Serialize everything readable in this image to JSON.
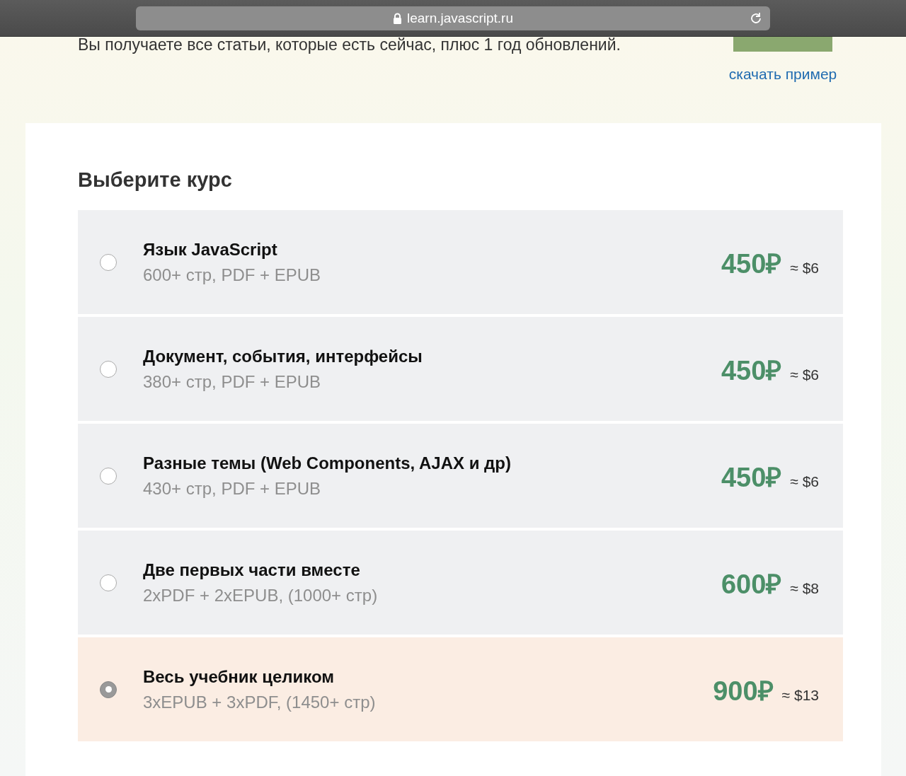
{
  "browser": {
    "url": "learn.javascript.ru"
  },
  "intro": {
    "text": "Вы получаете все статьи, которые есть сейчас, плюс 1 год обновлений.",
    "download_link": "скачать пример"
  },
  "course_picker": {
    "title": "Выберите курс",
    "options": [
      {
        "title": "Язык JavaScript",
        "details": "600+ стр, PDF + EPUB",
        "price": "450₽",
        "approx": "≈ $6",
        "selected": false
      },
      {
        "title": "Документ, события, интерфейсы",
        "details": "380+ стр, PDF + EPUB",
        "price": "450₽",
        "approx": "≈ $6",
        "selected": false
      },
      {
        "title": "Разные темы (Web Components, AJAX и др)",
        "details": "430+ стр, PDF + EPUB",
        "price": "450₽",
        "approx": "≈ $6",
        "selected": false
      },
      {
        "title": "Две первых части вместе",
        "details": "2xPDF + 2xEPUB, (1000+ стр)",
        "price": "600₽",
        "approx": "≈ $8",
        "selected": false
      },
      {
        "title": "Весь учебник целиком",
        "details": "3xEPUB + 3xPDF, (1450+ стр)",
        "price": "900₽",
        "approx": "≈ $13",
        "selected": true
      }
    ]
  }
}
